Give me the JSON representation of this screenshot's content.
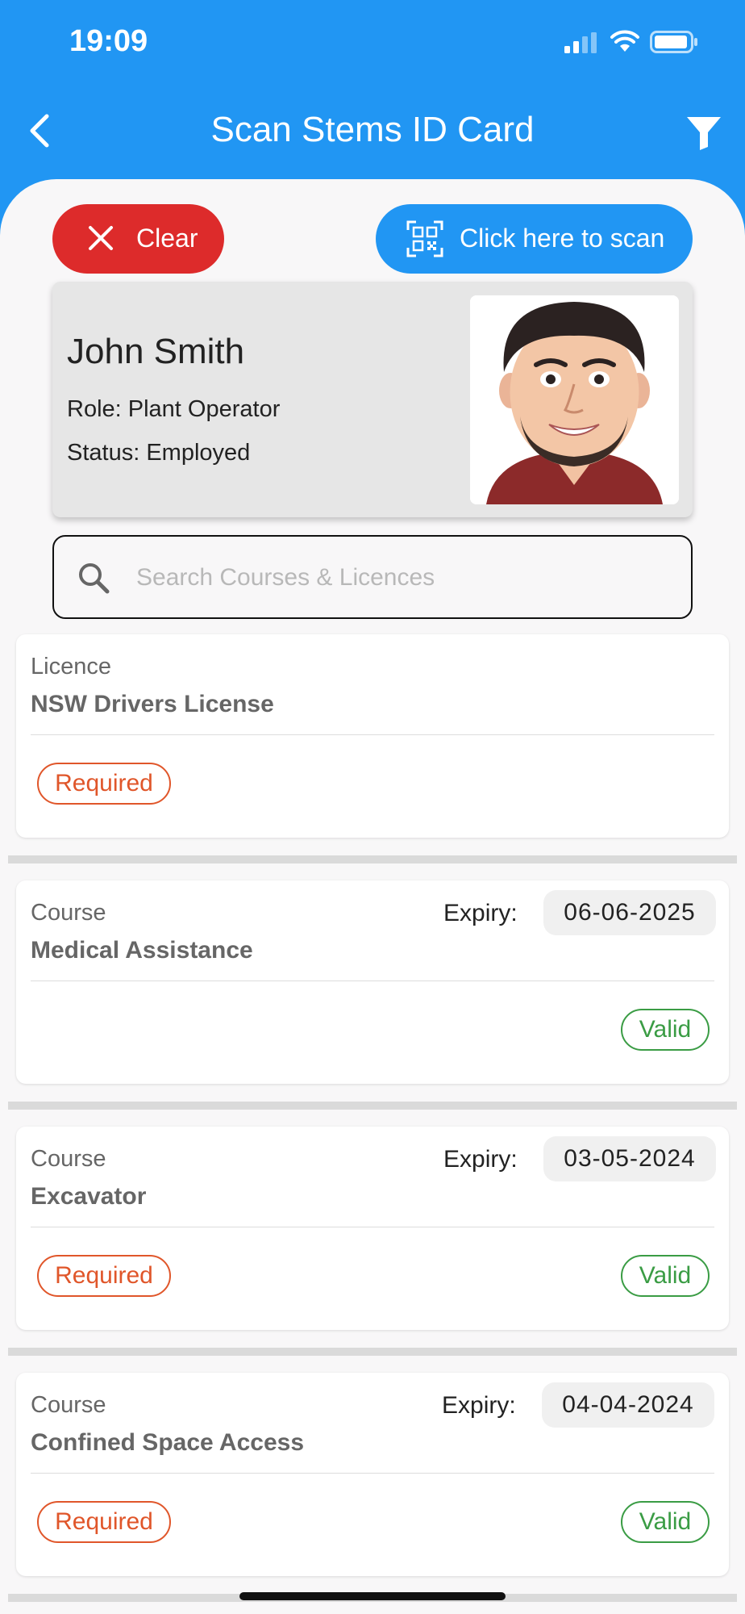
{
  "status_bar": {
    "time": "19:09"
  },
  "app_bar": {
    "title": "Scan Stems ID Card"
  },
  "actions": {
    "clear_label": "Clear",
    "scan_label": "Click here to scan"
  },
  "profile": {
    "name": "John Smith",
    "role": "Role: Plant Operator",
    "status": "Status: Employed"
  },
  "search": {
    "placeholder": "Search Courses & Licences"
  },
  "cards": [
    {
      "type": "Licence",
      "title": "NSW Drivers License",
      "required_label": "Required"
    },
    {
      "type": "Course",
      "title": "Medical Assistance",
      "expiry_label": "Expiry:",
      "expiry": "06-06-2025",
      "valid_label": "Valid"
    },
    {
      "type": "Course",
      "title": "Excavator",
      "expiry_label": "Expiry:",
      "expiry": "03-05-2024",
      "required_label": "Required",
      "valid_label": "Valid"
    },
    {
      "type": "Course",
      "title": "Confined Space Access",
      "expiry_label": "Expiry:",
      "expiry": "04-04-2024",
      "required_label": "Required",
      "valid_label": "Valid"
    }
  ],
  "colors": {
    "primary": "#2196f3",
    "danger": "#dd2b2b",
    "required": "#e0562a",
    "valid": "#3a9c44",
    "background": "#f8f7f8"
  },
  "icons": [
    "back-arrow-icon",
    "filter-icon",
    "close-icon",
    "qr-code-icon",
    "search-icon",
    "cellular-signal-icon",
    "wifi-icon",
    "battery-icon"
  ]
}
